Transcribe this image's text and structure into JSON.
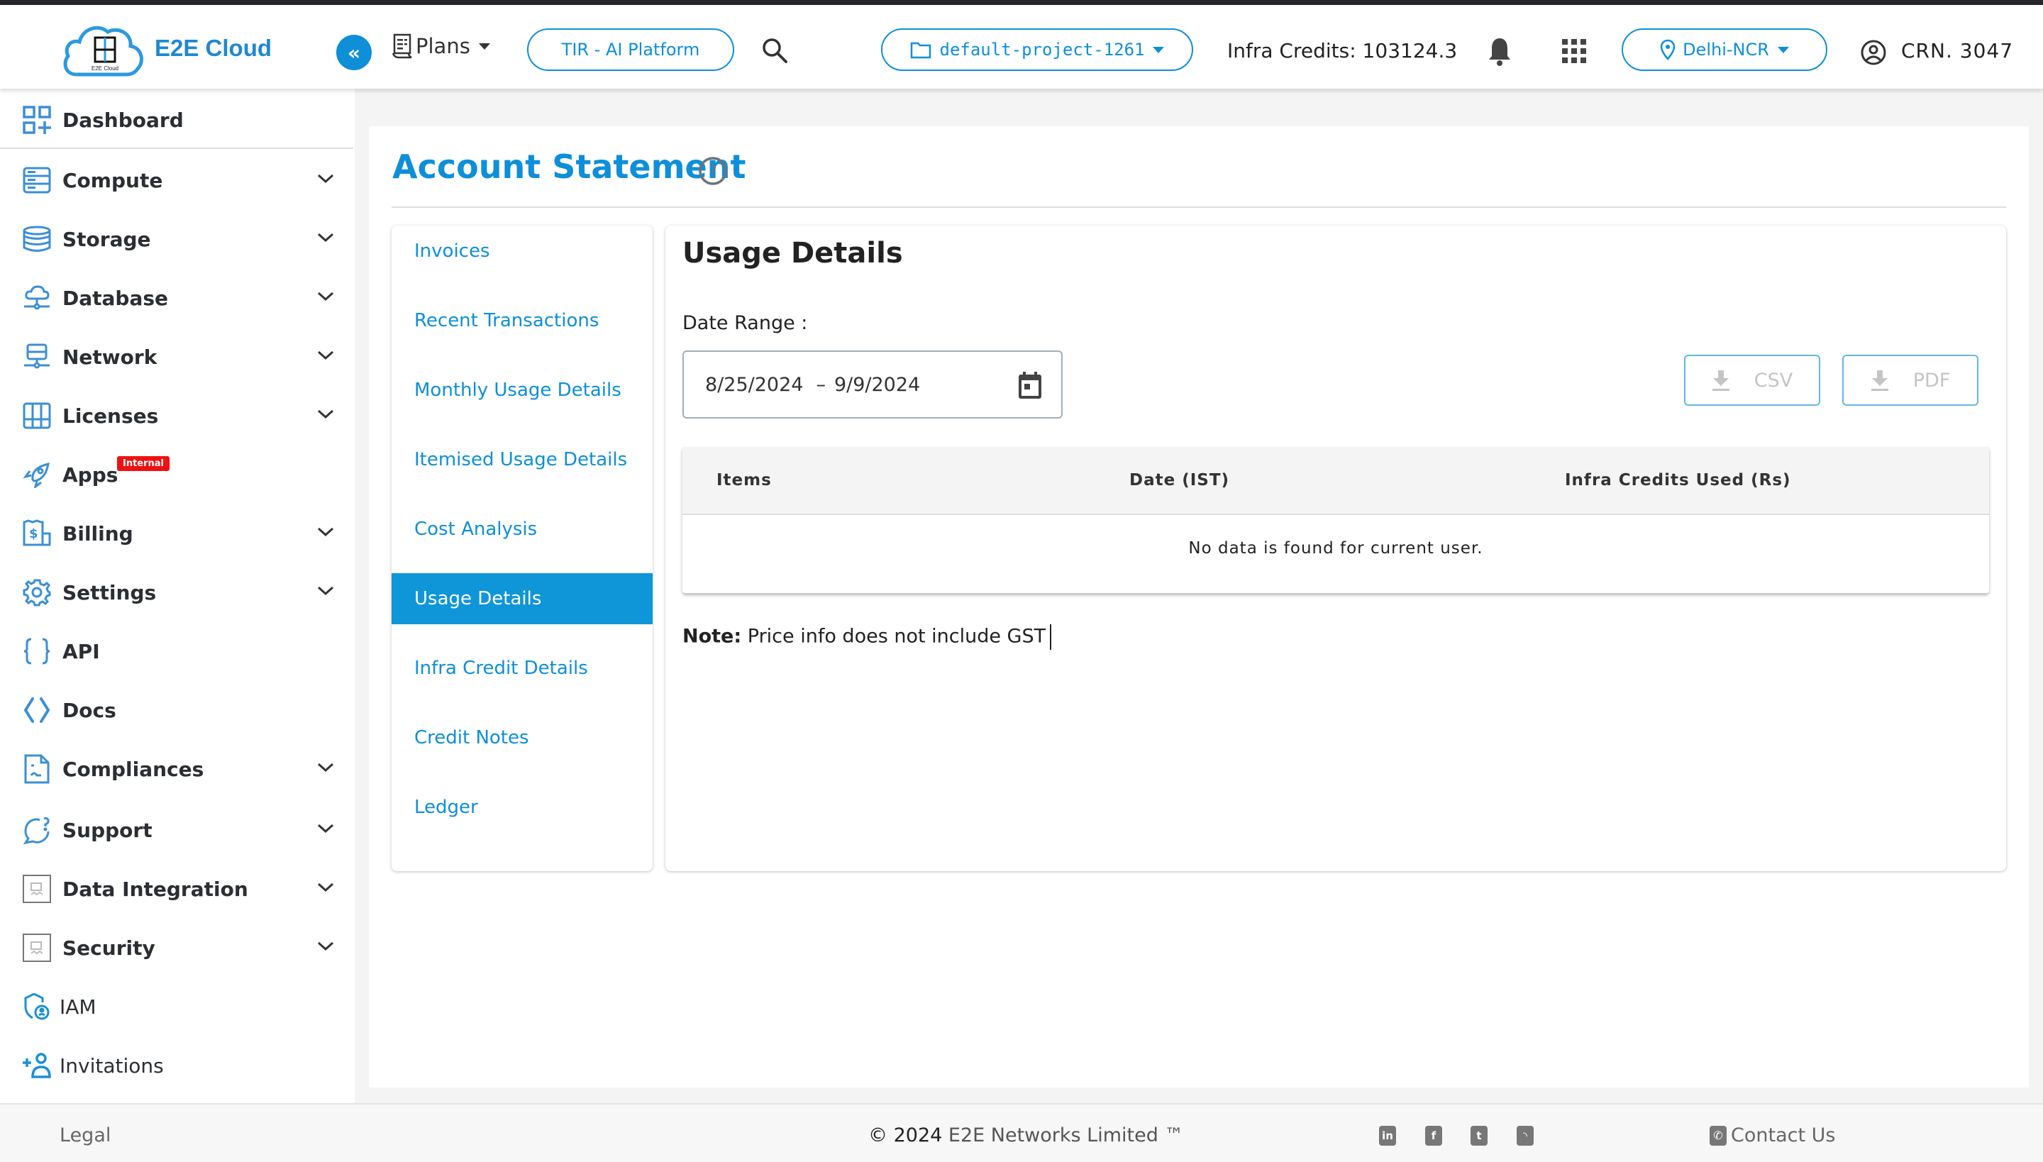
{
  "header": {
    "brand": "E2E Cloud",
    "logo_caption": "E2E Cloud",
    "collapse_icon": "double-chevron-left-icon",
    "plans_label": "Plans",
    "platform_label": "TIR - AI Platform",
    "project_label": "default-project-1261",
    "infra_credits": "Infra Credits: 103124.3",
    "region_label": "Delhi-NCR",
    "crn": "CRN. 3047"
  },
  "sidebar": {
    "items": [
      {
        "label": "Dashboard",
        "icon": "dashboard-icon",
        "expandable": false
      },
      {
        "label": "Compute",
        "icon": "server-icon",
        "expandable": true
      },
      {
        "label": "Storage",
        "icon": "database-stack-icon",
        "expandable": true
      },
      {
        "label": "Database",
        "icon": "cloud-network-icon",
        "expandable": true
      },
      {
        "label": "Network",
        "icon": "network-server-icon",
        "expandable": true
      },
      {
        "label": "Licenses",
        "icon": "license-grid-icon",
        "expandable": true
      },
      {
        "label": "Apps",
        "icon": "rocket-icon",
        "expandable": false,
        "badge": "Internal"
      },
      {
        "label": "Billing",
        "icon": "billing-receipt-icon",
        "expandable": true
      },
      {
        "label": "Settings",
        "icon": "gear-icon",
        "expandable": true
      },
      {
        "label": "API",
        "icon": "curly-braces-icon",
        "expandable": false
      },
      {
        "label": "Docs",
        "icon": "code-brackets-icon",
        "expandable": false
      },
      {
        "label": "Compliances",
        "icon": "document-icon",
        "expandable": true
      },
      {
        "label": "Support",
        "icon": "chat-question-icon",
        "expandable": true
      },
      {
        "label": "Data Integration",
        "icon": "broken-image-icon",
        "expandable": true
      },
      {
        "label": "Security",
        "icon": "broken-image-icon",
        "expandable": true
      },
      {
        "label": "IAM",
        "icon": "shield-user-icon",
        "expandable": false
      },
      {
        "label": "Invitations",
        "icon": "add-user-icon",
        "expandable": false
      }
    ]
  },
  "page": {
    "title": "Account Statement",
    "nav": [
      {
        "label": "Invoices",
        "active": false
      },
      {
        "label": "Recent Transactions",
        "active": false
      },
      {
        "label": "Monthly Usage Details",
        "active": false
      },
      {
        "label": "Itemised Usage Details",
        "active": false
      },
      {
        "label": "Cost Analysis",
        "active": false
      },
      {
        "label": "Usage Details",
        "active": true
      },
      {
        "label": "Infra Credit Details",
        "active": false
      },
      {
        "label": "Credit Notes",
        "active": false
      },
      {
        "label": "Ledger",
        "active": false
      }
    ],
    "panel": {
      "title": "Usage Details",
      "date_range_label": "Date Range :",
      "date_start": "8/25/2024",
      "date_separator": "–",
      "date_end": "9/9/2024",
      "csv_label": "CSV",
      "pdf_label": "PDF",
      "table": {
        "columns": [
          "Items",
          "Date (IST)",
          "Infra Credits Used (Rs)"
        ],
        "rows": [],
        "empty_message": "No data is found for current user."
      },
      "note_label": "Note:",
      "note_text": "Price info does not include GST"
    }
  },
  "footer": {
    "legal": "Legal",
    "copyright_symbol": "©",
    "year": "2024",
    "company": "E2E Networks Limited ™",
    "social": [
      "linkedin-icon",
      "facebook-icon",
      "twitter-icon",
      "rss-icon"
    ],
    "contact": "Contact Us"
  },
  "colors": {
    "accent": "#0e8fd8",
    "active_nav": "#0e96d8",
    "badge": "#ee1111",
    "topstrip": "#26262c"
  }
}
